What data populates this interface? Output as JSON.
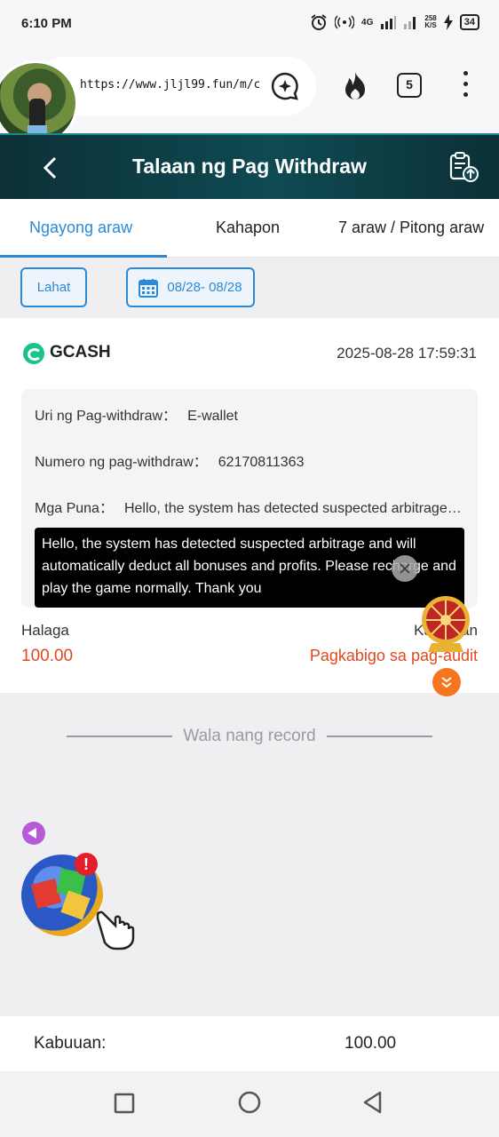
{
  "status_bar": {
    "time": "6:10 PM",
    "network": "4G",
    "speed_top": "258",
    "speed_bottom": "K/S",
    "battery": "34"
  },
  "browser": {
    "url": "https://www.jljl99.fun/m/c",
    "tab_count": "5"
  },
  "header": {
    "title": "Talaan ng Pag Withdraw"
  },
  "tabs": [
    {
      "label": "Ngayong araw",
      "active": true
    },
    {
      "label": "Kahapon",
      "active": false
    },
    {
      "label": "7 araw / Pitong araw",
      "active": false
    }
  ],
  "filters": {
    "all_label": "Lahat",
    "date_range": "08/28- 08/28"
  },
  "record": {
    "method": "GCASH",
    "datetime": "2025-08-28 17:59:31",
    "type_label": "Uri ng Pag-withdraw：",
    "type_value": "E-wallet",
    "number_label": "Numero ng pag-withdraw：",
    "number_value": "62170811363",
    "remarks_label": "Mga Puna：",
    "remarks_value": "Hello, the system has detected suspected arbitrage and will automatically deduct all bonuses and profits. Please recharge and play the game normally. Thank you",
    "tooltip_text": "Hello, the system has detected suspected arbitrage and will automatically deduct all bonuses and profits. Please recharge and play the game normally. Thank you",
    "amount_label": "Halaga",
    "amount_value": "100.00",
    "status_label": "Katayuan",
    "status_value": "Pagkabigo sa pag-audit"
  },
  "no_record": "Wala nang record",
  "total": {
    "label": "Kabuuan:",
    "value": "100.00"
  },
  "colors": {
    "accent": "#2a8ad8",
    "header_bg": "#0f4a52",
    "status_red": "#e0481f",
    "gcash_green": "#18c48a"
  }
}
